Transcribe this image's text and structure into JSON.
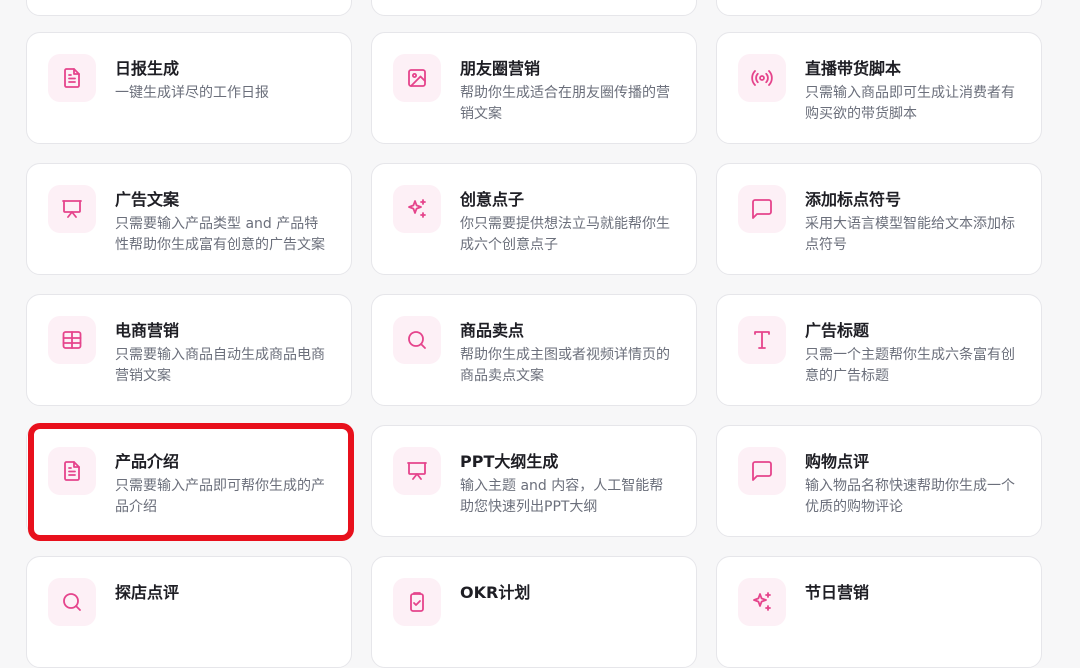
{
  "accent_color": "#e5448c",
  "highlight_color": "#e8101c",
  "cards": [
    {
      "title": "日报生成",
      "desc": "一键生成详尽的工作日报",
      "icon": "document-icon"
    },
    {
      "title": "朋友圈营销",
      "desc": "帮助你生成适合在朋友圈传播的营销文案",
      "icon": "image-icon"
    },
    {
      "title": "直播带货脚本",
      "desc": "只需输入商品即可生成让消费者有购买欲的带货脚本",
      "icon": "broadcast-icon"
    },
    {
      "title": "广告文案",
      "desc": "只需要输入产品类型 and 产品特性帮助你生成富有创意的广告文案",
      "icon": "presentation-icon"
    },
    {
      "title": "创意点子",
      "desc": "你只需要提供想法立马就能帮你生成六个创意点子",
      "icon": "sparkles-icon"
    },
    {
      "title": "添加标点符号",
      "desc": "采用大语言模型智能给文本添加标点符号",
      "icon": "message-square-icon"
    },
    {
      "title": "电商营销",
      "desc": "只需要输入商品自动生成商品电商营销文案",
      "icon": "table-icon"
    },
    {
      "title": "商品卖点",
      "desc": "帮助你生成主图或者视频详情页的商品卖点文案",
      "icon": "search-icon"
    },
    {
      "title": "广告标题",
      "desc": "只需一个主题帮你生成六条富有创意的广告标题",
      "icon": "type-icon"
    },
    {
      "title": "产品介绍",
      "desc": "只需要输入产品即可帮你生成的产品介绍",
      "icon": "document-icon"
    },
    {
      "title": "PPT大纲生成",
      "desc": "输入主题 and 内容，人工智能帮助您快速列出PPT大纲",
      "icon": "presentation-icon"
    },
    {
      "title": "购物点评",
      "desc": "输入物品名称快速帮助你生成一个优质的购物评论",
      "icon": "message-square-icon"
    },
    {
      "title": "探店点评",
      "desc": "",
      "icon": "search-icon"
    },
    {
      "title": "OKR计划",
      "desc": "",
      "icon": "clipboard-check-icon"
    },
    {
      "title": "节日营销",
      "desc": "",
      "icon": "sparkles-icon"
    }
  ]
}
